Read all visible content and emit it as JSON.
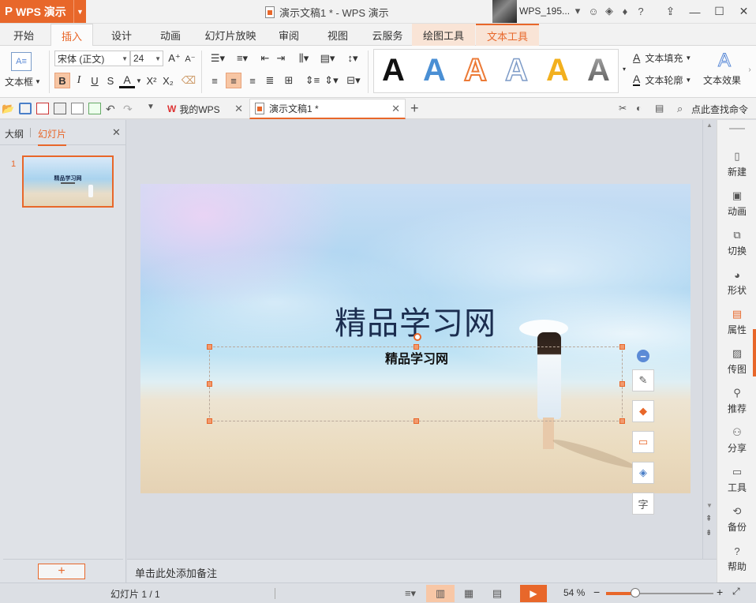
{
  "titlebar": {
    "app_name": "WPS 演示",
    "app_logo": "P",
    "document_title": "演示文稿1 * - WPS 演示",
    "user_name": "WPS_195...",
    "window_controls": [
      "minimize",
      "maximize",
      "close"
    ]
  },
  "ribbon_tabs": [
    "开始",
    "插入",
    "设计",
    "动画",
    "幻灯片放映",
    "审阅",
    "视图",
    "云服务",
    "绘图工具",
    "文本工具"
  ],
  "ribbon": {
    "textbox_label": "文本框",
    "font_name": "宋体 (正文)",
    "font_size": "24",
    "bold": "B",
    "italic": "I",
    "underline": "U",
    "strike": "S",
    "font_color": "A",
    "superscript": "X²",
    "subscript": "X₂",
    "text_fill": "文本填充",
    "text_outline": "文本轮廓",
    "text_effect": "文本效果",
    "style_letter": "A",
    "style_colors": [
      "#111111",
      "#4a8fd4",
      "#ec7a36",
      "#dfe8f2",
      "#f2b01e",
      "#8a8a8a"
    ]
  },
  "doc_tabs": {
    "my_wps": "我的WPS",
    "current_doc": "演示文稿1 *",
    "search": "点此查找命令"
  },
  "left_panel": {
    "outline_tab": "大纲",
    "slides_tab": "幻灯片",
    "slide_number": "1",
    "thumb_title": "精品学习网"
  },
  "slide": {
    "title": "精品学习网",
    "textbox_text": "精品学习网"
  },
  "notes_placeholder": "单击此处添加备注",
  "side_panel": [
    "新建",
    "动画",
    "切换",
    "形状",
    "属性",
    "传图",
    "推荐",
    "分享",
    "工具",
    "备份",
    "帮助"
  ],
  "status": {
    "slide_info": "幻灯片 1 / 1",
    "zoom": "54 %",
    "zoom_level": 0.27
  },
  "colors": {
    "accent": "#e8672a"
  }
}
